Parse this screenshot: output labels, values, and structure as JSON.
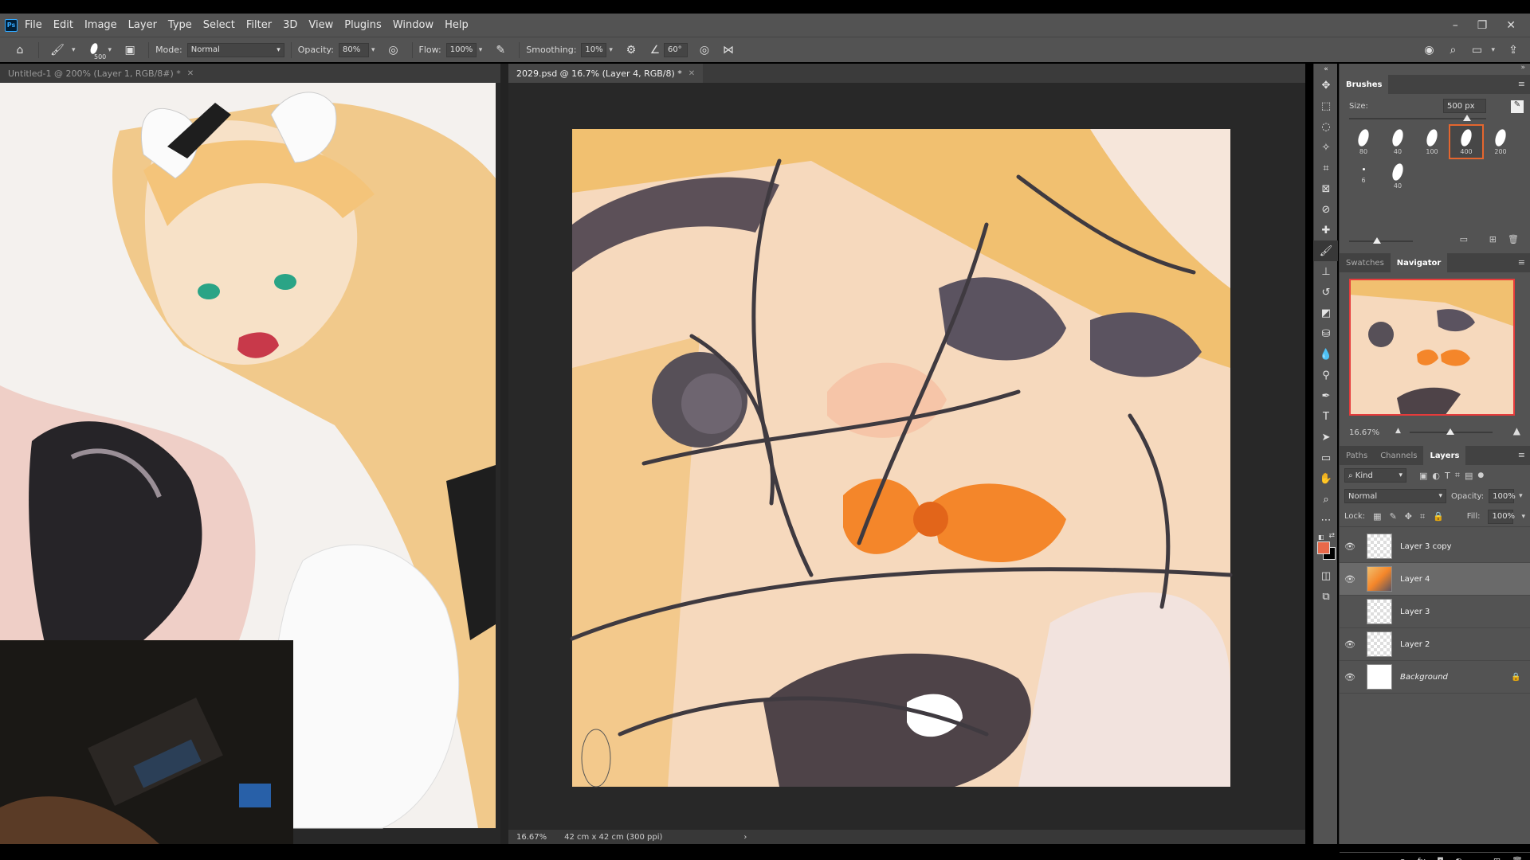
{
  "app": {
    "menus": [
      "File",
      "Edit",
      "Image",
      "Layer",
      "Type",
      "Select",
      "Filter",
      "3D",
      "View",
      "Plugins",
      "Window",
      "Help"
    ],
    "logo": "Ps",
    "window_controls": [
      "–",
      "❐",
      "✕"
    ]
  },
  "options": {
    "brush_size": "500",
    "mode_label": "Mode:",
    "mode_value": "Normal",
    "opacity_label": "Opacity:",
    "opacity_value": "80%",
    "flow_label": "Flow:",
    "flow_value": "100%",
    "smoothing_label": "Smoothing:",
    "smoothing_value": "10%",
    "angle_value": "60°"
  },
  "left_doc": {
    "tab_title": "Untitled-1 @ 200% (Layer 1, RGB/8#) *"
  },
  "main_doc": {
    "tab_title": "2029.psd @ 16.7% (Layer 4, RGB/8) *",
    "status_zoom": "16.67%",
    "status_info": "42 cm x 42 cm (300 ppi)"
  },
  "brushes_panel": {
    "title": "Brushes",
    "size_label": "Size:",
    "size_value": "500 px",
    "brushes": [
      {
        "size": "80",
        "selected": false
      },
      {
        "size": "40",
        "selected": false
      },
      {
        "size": "100",
        "selected": false
      },
      {
        "size": "400",
        "selected": true
      },
      {
        "size": "200",
        "selected": false
      },
      {
        "size": "6",
        "selected": false
      },
      {
        "size": "40",
        "selected": false
      }
    ]
  },
  "navigator_panel": {
    "tabs": [
      "Swatches",
      "Navigator"
    ],
    "zoom": "16.67%"
  },
  "layers_panel": {
    "tabs": [
      "Paths",
      "Channels",
      "Layers"
    ],
    "filter_value": "Kind",
    "blend_mode": "Normal",
    "opacity_label": "Opacity:",
    "opacity_value": "100%",
    "lock_label": "Lock:",
    "fill_label": "Fill:",
    "fill_value": "100%",
    "layers": [
      {
        "name": "Layer 3 copy",
        "visible": true,
        "selected": false
      },
      {
        "name": "Layer 4",
        "visible": true,
        "selected": true
      },
      {
        "name": "Layer 3",
        "visible": false,
        "selected": false
      },
      {
        "name": "Layer 2",
        "visible": true,
        "selected": false
      },
      {
        "name": "Background",
        "visible": true,
        "selected": false,
        "locked": true
      }
    ]
  },
  "colors": {
    "foreground": "#e8694a",
    "background": "#000000",
    "selection_accent": "#e5662e"
  }
}
